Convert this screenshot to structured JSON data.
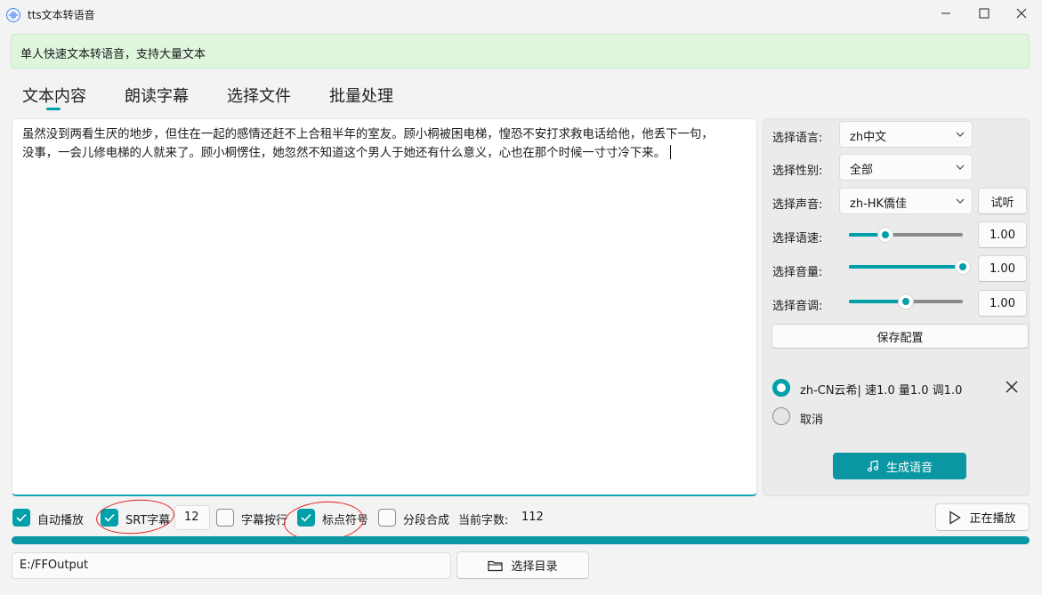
{
  "window": {
    "title": "tts文本转语音"
  },
  "banner": {
    "text": "单人快速文本转语音，支持大量文本"
  },
  "tabs": [
    {
      "label": "文本内容",
      "active": true
    },
    {
      "label": "朗读字幕",
      "active": false
    },
    {
      "label": "选择文件",
      "active": false
    },
    {
      "label": "批量处理",
      "active": false
    }
  ],
  "editor": {
    "line1": "虽然没到两看生厌的地步，但住在一起的感情还赶不上合租半年的室友。顾小桐被困电梯，惶恐不安打求救电话给他，他丢下一句，",
    "line2": "没事，一会儿修电梯的人就来了。顾小桐愣住，她忽然不知道这个男人于她还有什么意义，心也在那个时候一寸寸冷下来。"
  },
  "settings": {
    "language": {
      "label": "选择语言:",
      "value": "zh中文"
    },
    "gender": {
      "label": "选择性别:",
      "value": "全部"
    },
    "voice": {
      "label": "选择声音:",
      "value": "zh-HK僑佳",
      "audition_label": "试听"
    },
    "speed": {
      "label": "选择语速:",
      "value": "1.00",
      "level": 0.32
    },
    "volume": {
      "label": "选择音量:",
      "value": "1.00",
      "level": 1.0
    },
    "pitch": {
      "label": "选择音调:",
      "value": "1.00",
      "level": 0.5
    },
    "save_label": "保存配置"
  },
  "queue": {
    "items": [
      {
        "label": "zh-CN云希| 速1.0 量1.0 调1.0",
        "selected": true
      },
      {
        "label": "取消",
        "selected": false
      }
    ]
  },
  "generate_label": "生成语音",
  "options": {
    "autoplay": {
      "label": "自动播放",
      "checked": true
    },
    "srt": {
      "label": "SRT字幕",
      "checked": true
    },
    "srt_size": "12",
    "subtitle_wrap": {
      "label": "字幕按行",
      "checked": false
    },
    "punctuation": {
      "label": "标点符号",
      "checked": true
    },
    "segment": {
      "label": "分段合成",
      "checked": false
    },
    "char_count_label": "当前字数:",
    "char_count": "112"
  },
  "playing_label": "正在播放",
  "output": {
    "path": "E:/FFOutput",
    "select_dir_label": "选择目录"
  },
  "colors": {
    "accent": "#009faa",
    "banner_bg": "#dff6dd",
    "annotation": "#e02020"
  }
}
